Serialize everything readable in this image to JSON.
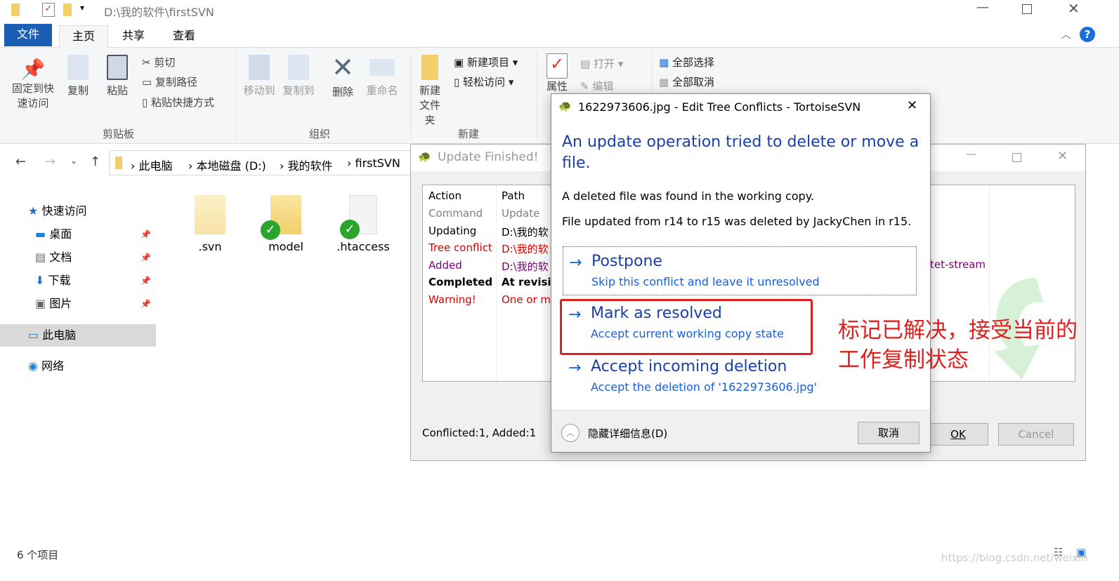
{
  "explorer": {
    "path_title": "D:\\我的软件\\firstSVN",
    "tabs": [
      "文件",
      "主页",
      "共享",
      "查看"
    ],
    "ribbon": {
      "pin": "固定到快速访问",
      "copy": "复制",
      "paste": "粘贴",
      "cut": "剪切",
      "copy_path": "复制路径",
      "paste_shortcut": "粘贴快捷方式",
      "group_clipboard": "剪贴板",
      "move_to": "移动到",
      "copy_to": "复制到",
      "delete": "删除",
      "rename": "重命名",
      "group_organize": "组织",
      "new_folder": "新建文件夹",
      "new_item": "新建项目",
      "easy_access": "轻松访问",
      "group_new": "新建",
      "properties": "属性",
      "open": "打开",
      "edit": "编辑",
      "select_all": "全部选择",
      "select_none": "全部取消"
    },
    "breadcrumb": [
      "此电脑",
      "本地磁盘 (D:)",
      "我的软件",
      "firstSVN"
    ],
    "nav": [
      "快速访问",
      "桌面",
      "文档",
      "下载",
      "图片",
      "此电脑",
      "网络"
    ],
    "files": [
      {
        "name": ".svn",
        "svn": false
      },
      {
        "name": "model",
        "svn": true
      },
      {
        "name": ".htaccess",
        "svn": true
      }
    ],
    "status": "6 个项目"
  },
  "update_dialog": {
    "title": "Update Finished!",
    "columns": [
      "Action",
      "Path"
    ],
    "rows": [
      {
        "action": "Command",
        "path": "Update",
        "color": "#808080"
      },
      {
        "action": "Updating",
        "path": "D:\\我的软",
        "color": "#000000"
      },
      {
        "action": "Tree conflict",
        "path": "D:\\我的软",
        "color": "#e00000"
      },
      {
        "action": "Added",
        "path": "D:\\我的软",
        "color": "#800080"
      },
      {
        "action": "Completed",
        "path": "At revisi",
        "color": "#000000",
        "bold": true
      },
      {
        "action": "Warning!",
        "path": "One or m",
        "color": "#e00000"
      }
    ],
    "mime_fragment": "tet-stream",
    "summary": "Conflicted:1, Added:1",
    "ok": "OK",
    "cancel": "Cancel"
  },
  "tree_conflict_dialog": {
    "title": "1622973606.jpg - Edit Tree Conflicts - TortoiseSVN",
    "heading": "An update operation tried to delete or move a file.",
    "line1": "A deleted file was found in the working copy.",
    "line2": "File updated from r14 to r15 was deleted by JackyChen in r15.",
    "options": [
      {
        "title": "Postpone",
        "sub": "Skip this conflict and leave it unresolved"
      },
      {
        "title": "Mark as resolved",
        "sub": "Accept current working copy state"
      },
      {
        "title": "Accept incoming deletion",
        "sub": "Accept the deletion of '1622973606.jpg'"
      }
    ],
    "hide_details": "隐藏详细信息(D)",
    "cancel": "取消"
  },
  "annotation": {
    "line1": "标记已解决，接受当前的",
    "line2": "工作复制状态",
    "color": "#e02020"
  },
  "watermark": "https://blog.csdn.net/weixin"
}
